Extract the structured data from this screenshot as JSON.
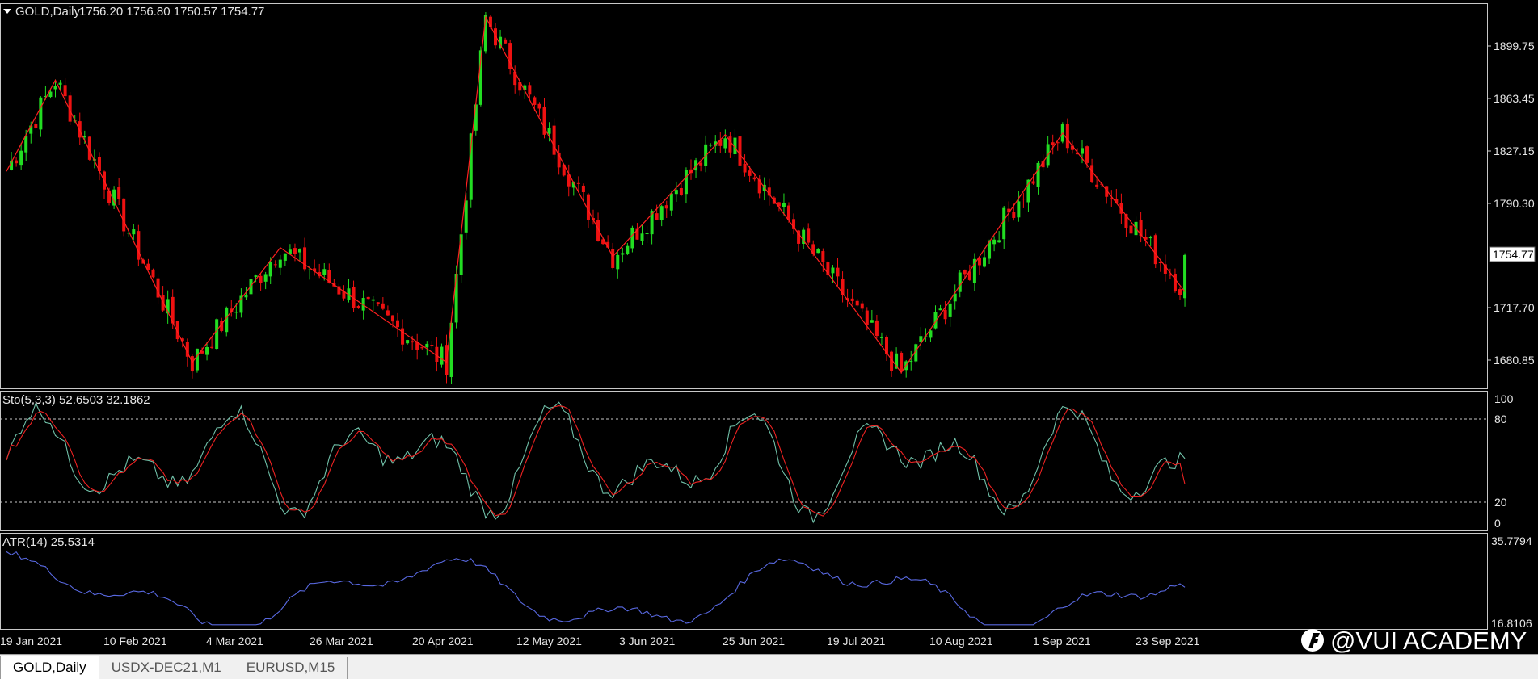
{
  "main_panel": {
    "symbol_label": "GOLD,Daily",
    "ohlc": "1756.20 1756.80 1750.57 1754.77",
    "price_labels": [
      "1899.75",
      "1863.45",
      "1827.15",
      "1790.30",
      "1754.77",
      "1717.70",
      "1680.85"
    ],
    "current_price": "1754.77"
  },
  "stochastic_panel": {
    "label": "Sto(5,3,3) 52.6503 32.1862",
    "levels": [
      "100",
      "80",
      "20",
      "0"
    ]
  },
  "atr_panel": {
    "label": "ATR(14) 25.5314",
    "levels": [
      "35.7794",
      "16.8106"
    ]
  },
  "time_axis": [
    "19 Jan 2021",
    "10 Feb 2021",
    "4 Mar 2021",
    "26 Mar 2021",
    "20 Apr 2021",
    "12 May 2021",
    "3 Jun 2021",
    "25 Jun 2021",
    "19 Jul 2021",
    "10 Aug 2021",
    "1 Sep 2021",
    "23 Sep 2021"
  ],
  "watermark": "@VUI ACADEMY",
  "tabs": [
    {
      "label": "GOLD,Daily",
      "active": true
    },
    {
      "label": "USDX-DEC21,M1",
      "active": false
    },
    {
      "label": "EURUSD,M15",
      "active": false
    }
  ],
  "colors": {
    "bull": "#22dd22",
    "bear": "#ee1111",
    "zigzag": "#ff2020",
    "sto_main": "#70c0a8",
    "sto_signal": "#ee2222",
    "atr": "#5868e0"
  },
  "chart_data": {
    "type": "candlestick",
    "zigzag_pivots": [
      1810,
      1872,
      1680,
      1758,
      1680,
      1915,
      1752,
      1835,
      1673,
      1836,
      1728
    ],
    "price_ylim": [
      1665,
      1920
    ],
    "stochastic": {
      "params": [
        5,
        3,
        3
      ],
      "main_last": 52.6503,
      "signal_last": 32.1862,
      "levels": [
        80,
        20
      ]
    },
    "atr": {
      "period": 14,
      "last": 25.5314,
      "ylim": [
        16.8106,
        35.7794
      ]
    }
  }
}
